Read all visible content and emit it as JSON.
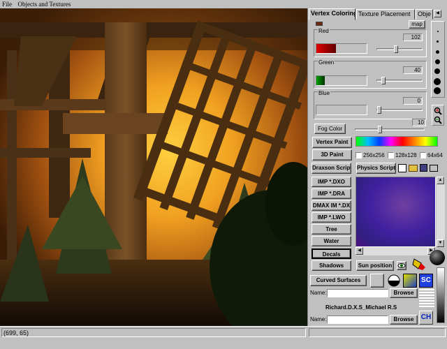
{
  "menu": {
    "file": "File",
    "objects": "Objects and Textures"
  },
  "tabs": [
    "Vertex Coloring",
    "Texture Placement",
    "Obje"
  ],
  "vertex": {
    "map_label": "map",
    "red_label": "Red",
    "red_value": "102",
    "green_label": "Green",
    "green_value": "40",
    "blue_label": "Blue",
    "blue_value": "0",
    "fog_label": "Fog Color",
    "fog_value": "10",
    "colors": {
      "red_swatch": "#c00000",
      "green_swatch": "#006000",
      "top_swatch": "#6b2a10"
    }
  },
  "buttons": {
    "vertex_paint": "Vertex Paint",
    "paint_3d": "3D Paint",
    "draxson_script": "Draxson Script",
    "physics_script": "Physics Script",
    "imp_dxo": "IMP *.DXO",
    "imp_dra": "IMP *.DRA",
    "dmax_im_dx": "DMAX IM *.DX",
    "imp_lwo": "IMP *.LWO",
    "tree": "Tree",
    "water": "Water",
    "decals": "Decals",
    "shadows": "Shadows",
    "sun_position": "Sun position",
    "curved_surfaces": "Curved Surfaces",
    "browse_1": "Browse",
    "browse_2": "Browse",
    "sc": "SC",
    "ch": "CH"
  },
  "texture_sizes": [
    "256x256",
    "128x128",
    "64x64"
  ],
  "name_label_1": "Name:",
  "name_label_2": "Name:",
  "credits": "Richard.D.X.S_Michael R.S",
  "status": {
    "coords": "(699, 65)"
  },
  "icons": [
    "zoom-in-icon",
    "zoom-out-icon",
    "new-file-icon",
    "open-file-icon",
    "save-file-icon",
    "print-icon",
    "eye-icon",
    "paint-bucket-icon"
  ]
}
